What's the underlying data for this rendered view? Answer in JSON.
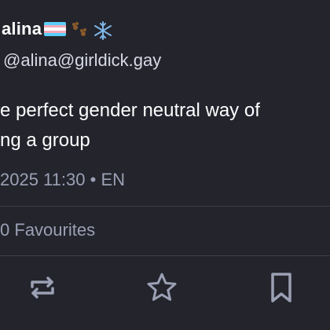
{
  "post": {
    "display_name": "alina",
    "handle": "@alina@girldick.gay",
    "content_lines": [
      "e perfect gender neutral way of",
      "ng a group"
    ],
    "timestamp": "2025 11:30",
    "separator": "•",
    "language": "EN",
    "favourites_count": "0",
    "favourites_label": "Favourites"
  },
  "flag_colors": [
    "#5bcefa",
    "#f5a9b8",
    "#ffffff",
    "#f5a9b8",
    "#5bcefa"
  ],
  "colors": {
    "background": "#23242c",
    "text": "#ffffff",
    "muted": "#9ba0b4",
    "divider": "#3c3e4b",
    "icon": "#9ba0b4"
  },
  "icons": {
    "boost": "boost-icon",
    "favourite": "star-icon",
    "bookmark": "bookmark-icon"
  }
}
